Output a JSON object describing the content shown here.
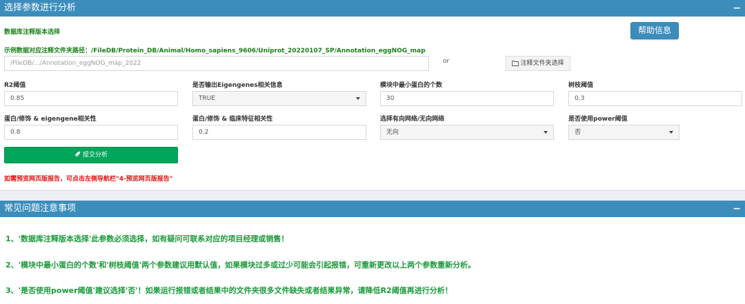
{
  "panel1": {
    "title": "选择参数进行分析",
    "collapse": "−",
    "db_label": "数据库注释版本选择",
    "help_button": "帮助信息",
    "example_path_label": "示例数据对应注释文件夹路径：/FileDB/Protein_DB/Animal/Homo_sapiens_9606/Uniprot_20220107_SP/Annotation_eggNOG_map",
    "path_input_placeholder": "/FileDB/.../Annotation_eggNOG_map_2022",
    "or_text": "or",
    "folder_button": "注释文件夹选择",
    "fields": {
      "r2_label": "R2阈值",
      "r2_value": "0.85",
      "eigengenes_label": "是否输出Eigengenes相关信息",
      "eigengenes_value": "TRUE",
      "min_module_label": "模块中最小蛋白的个数",
      "min_module_value": "30",
      "tree_cut_label": "树枝阈值",
      "tree_cut_value": "0.3",
      "prot_eigen_label": "蛋白/修饰 & eigengene相关性",
      "prot_eigen_value": "0.8",
      "prot_clinical_label": "蛋白/修饰 & 临床特征相关性",
      "prot_clinical_value": "0.2",
      "network_label": "选择有向网络/无向网络",
      "network_value": "无向",
      "power_label": "是否使用power阈值",
      "power_value": "否"
    },
    "submit_button": "提交分析",
    "report_note": "如需预览网页版报告，可点击左侧导航栏\"4-预览网页版报告\""
  },
  "panel2": {
    "title": "常见问题注意事项",
    "collapse": "−",
    "items": [
      "1、'数据库注释版本选择'此参数必须选择，如有疑问可联系对应的项目经理或销售！",
      "2、'模块中最小蛋白的个数'和'树枝阈值'两个参数建议用默认值，如果模块过多或过少可能会引起报错，可重新更改以上两个参数重新分析。",
      "3、'是否使用power阈值'建议选择'否'！如果运行报错或者结果中的文件夹很多文件缺失或者结果异常，请降低R2阈值再进行分析！"
    ]
  },
  "colors": {
    "header_blue": "#3c8dbc",
    "green_text": "#1a9a3a",
    "submit_green": "#00a65a",
    "note_red": "#dd1111"
  },
  "icons": {
    "folder": "folder-icon",
    "rocket": "rocket-icon",
    "dropdown": "chevron-down-icon"
  }
}
